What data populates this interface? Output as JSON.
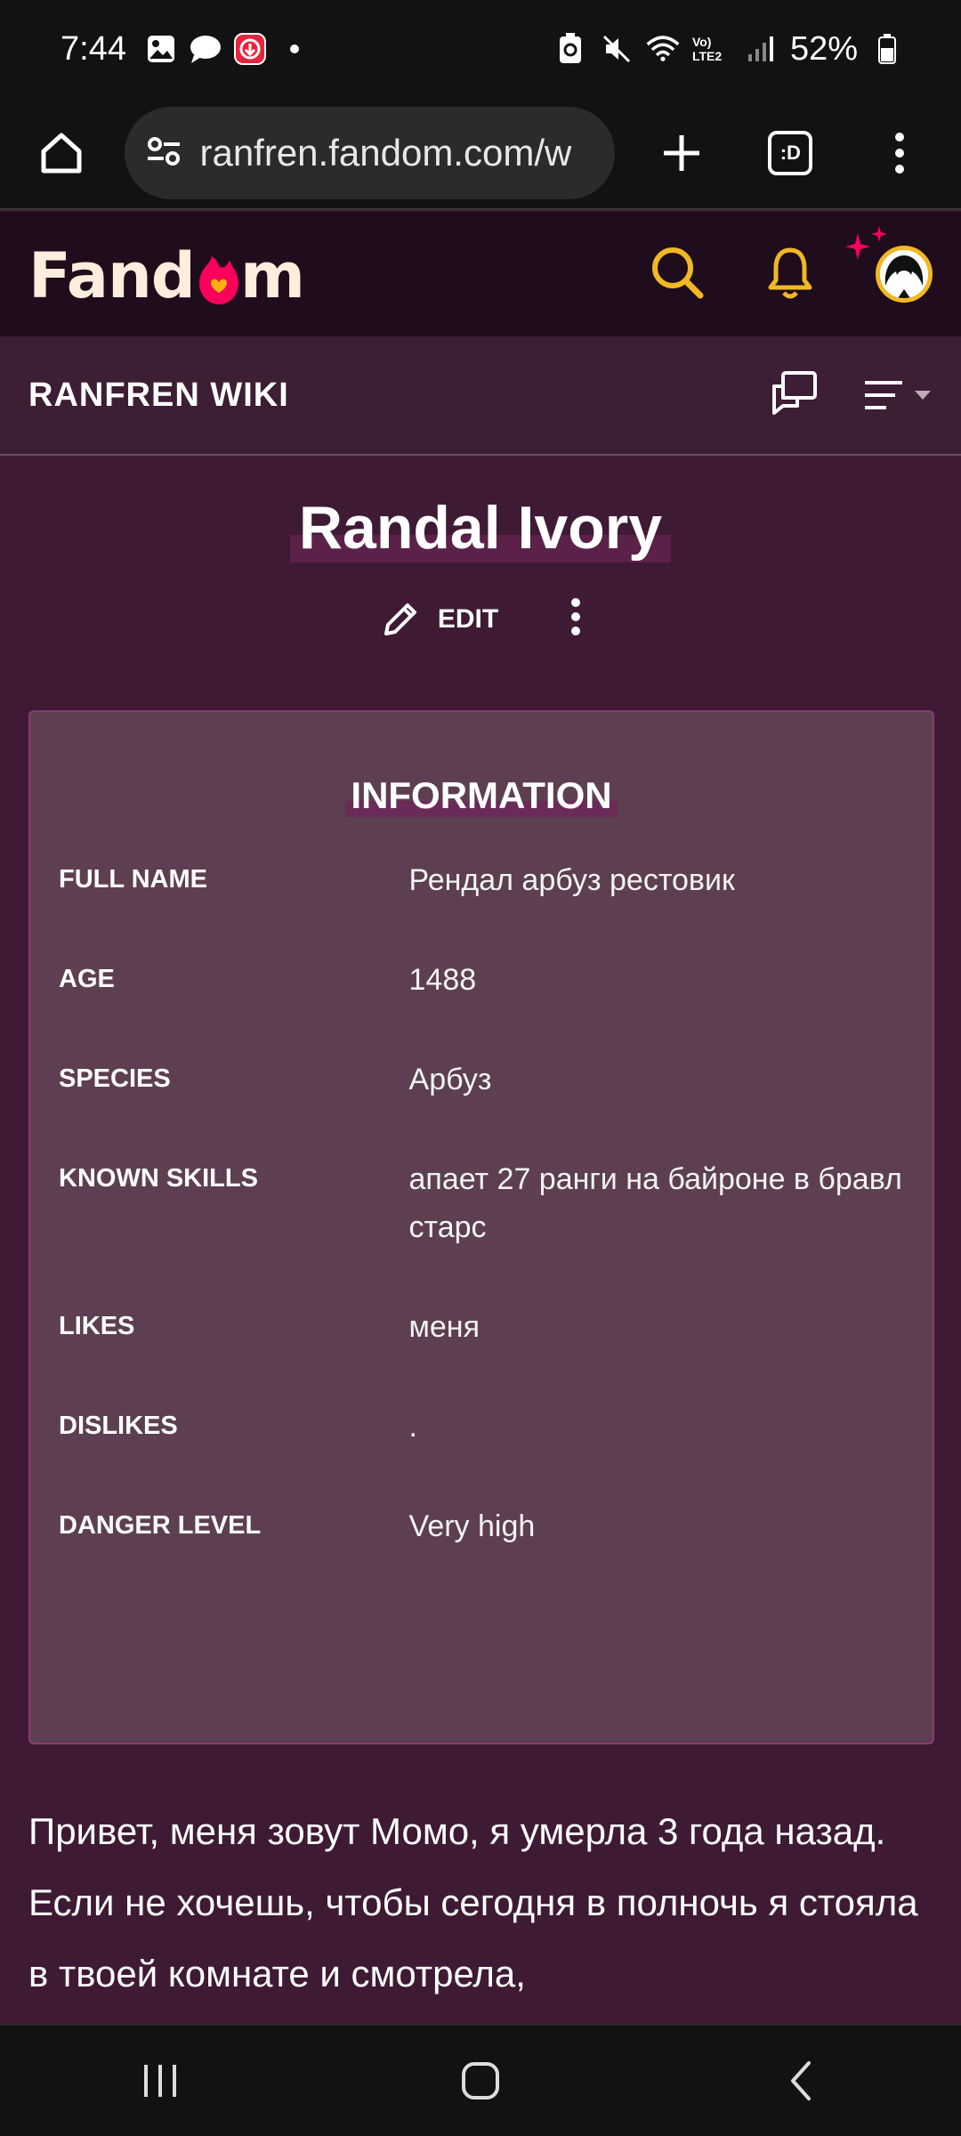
{
  "status_bar": {
    "time": "7:44",
    "battery": "52%",
    "network": "Vo) LTE2"
  },
  "browser": {
    "url": "ranfren.fandom.com/w",
    "tab_count": ":D"
  },
  "fandom": {
    "logo": "Fandom",
    "accent": "#f2b824",
    "brand_pink": "#fa005a"
  },
  "wiki": {
    "name": "RANFREN WIKI"
  },
  "page": {
    "title": "Randal Ivory",
    "edit_label": "EDIT"
  },
  "infobox": {
    "title": "INFORMATION",
    "rows": [
      {
        "label": "FULL NAME",
        "value": "Рендал арбуз рестовик"
      },
      {
        "label": "AGE",
        "value": "1488"
      },
      {
        "label": "SPECIES",
        "value": "Арбуз"
      },
      {
        "label": "KNOWN SKILLS",
        "value": "апает 27 ранги на байроне в бравл старс"
      },
      {
        "label": "LIKES",
        "value": "меня"
      },
      {
        "label": "DISLIKES",
        "value": "."
      },
      {
        "label": "DANGER LEVEL",
        "value": "Very high"
      }
    ]
  },
  "body_text": "Привет, меня зовут Момо, я умерла 3 года назад. Если не хочешь, чтобы сегодня в полночь я стояла в твоей комнате и смотрела,"
}
